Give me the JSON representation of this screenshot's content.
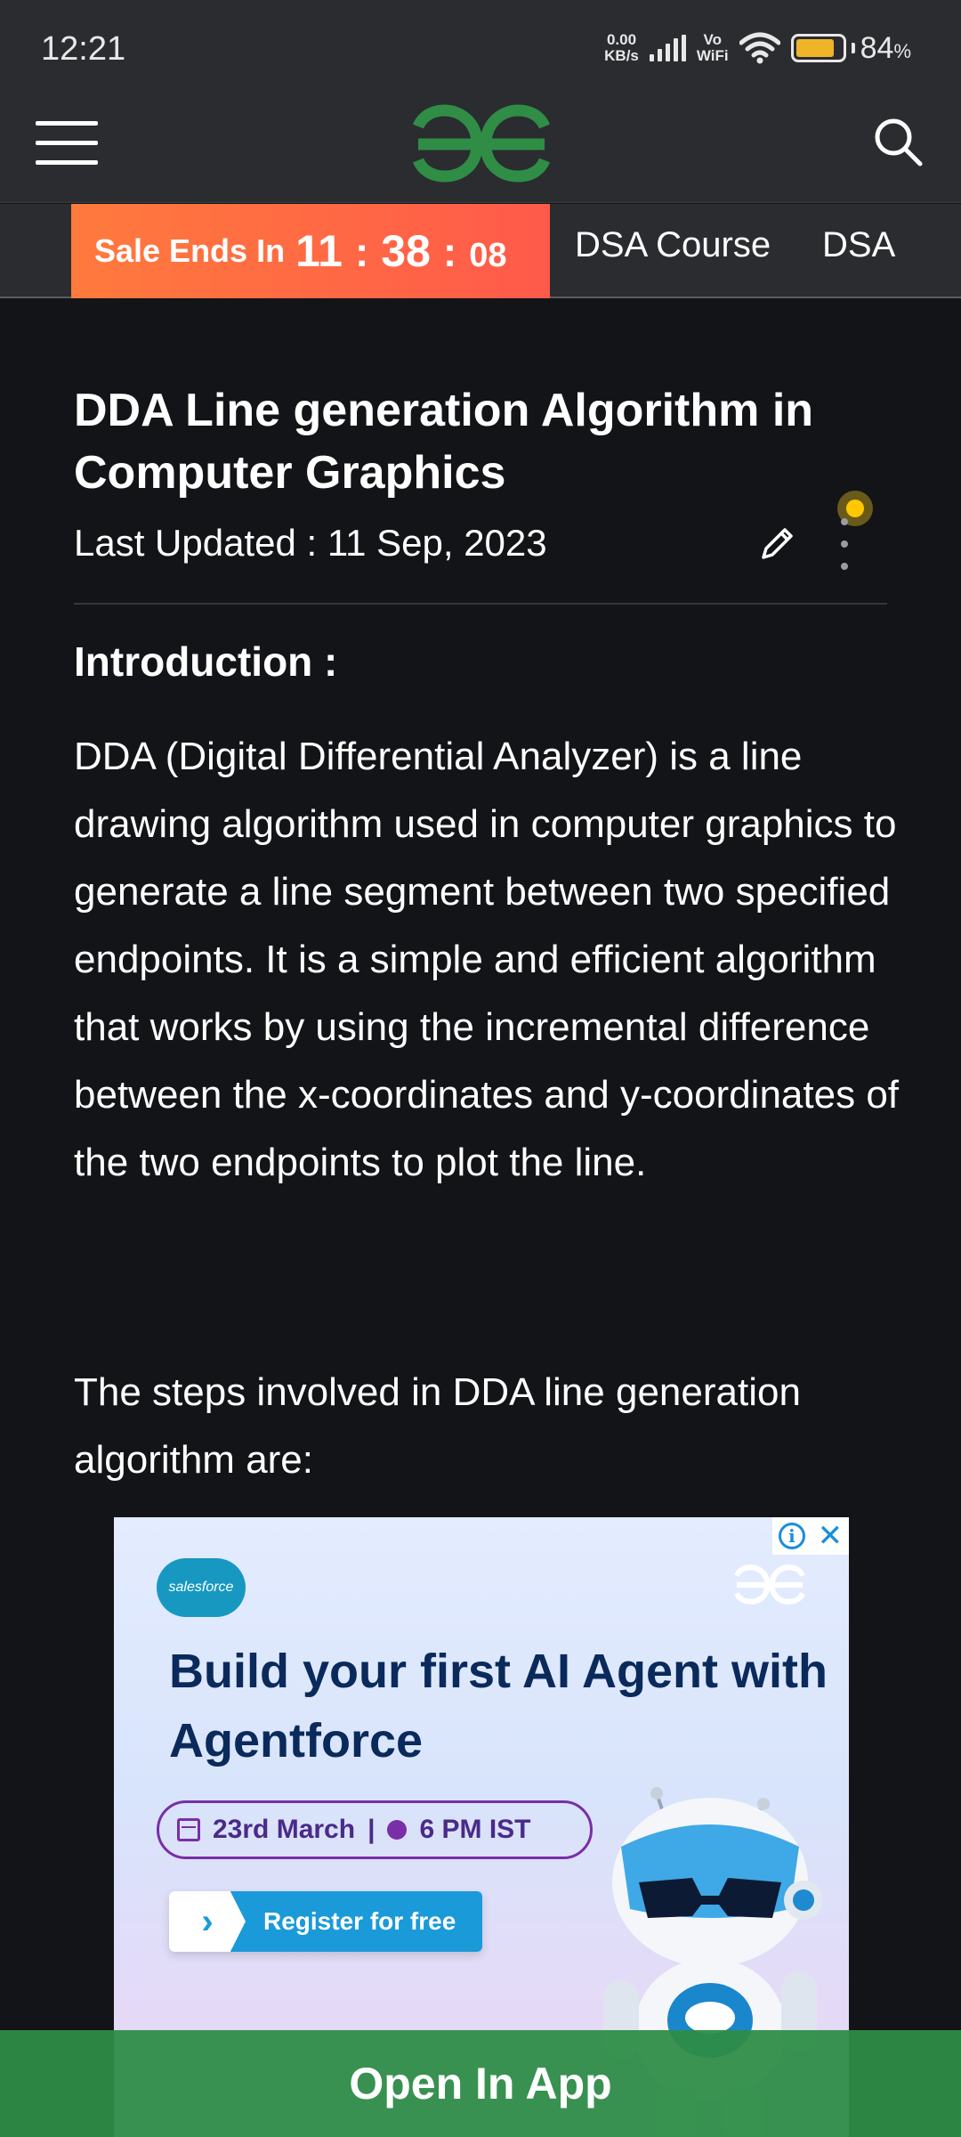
{
  "status_bar": {
    "time": "12:21",
    "net_speed_value": "0.00",
    "net_speed_unit": "KB/s",
    "vowifi_top": "Vo",
    "vowifi_bottom": "WiFi",
    "battery_percent": "84",
    "battery_unit": "%",
    "battery_level": 0.84,
    "battery_color": "#f0b428",
    "icons": [
      "signal-icon",
      "wifi-icon",
      "battery-icon"
    ]
  },
  "header": {
    "menu_icon": "hamburger-menu-icon",
    "logo": "geeksforgeeks-logo",
    "logo_color": "#2f8d46",
    "search_icon": "search-icon"
  },
  "nav": {
    "sale_label": "Sale Ends In",
    "timer": {
      "hours": "11",
      "minutes": "38",
      "seconds": "08",
      "separator": ":"
    },
    "links": [
      "DSA Course",
      "DSA"
    ]
  },
  "article": {
    "title": "DDA Line generation Algorithm in Computer Graphics",
    "last_updated": "Last Updated : 11 Sep, 2023",
    "intro_heading": "Introduction :",
    "paragraph_1": "DDA (Digital Differential Analyzer) is a line drawing algorithm used in computer graphics to generate a line segment between two specified endpoints. It is a simple and efficient algorithm that works by using the incremental difference between the x-coordinates and y-coordinates of the two endpoints to plot the line.",
    "paragraph_2": "The steps involved in DDA line generation algorithm are:"
  },
  "ad": {
    "brand": "salesforce",
    "headline": "Build your first AI Agent with Agentforce",
    "date": "23rd March",
    "divider": "|",
    "time": "6 PM IST",
    "cta": "Register for free",
    "info_icon": "i",
    "close_icon": "✕"
  },
  "bottom_bar": {
    "label": "Open In App",
    "color": "#2e8c46"
  }
}
